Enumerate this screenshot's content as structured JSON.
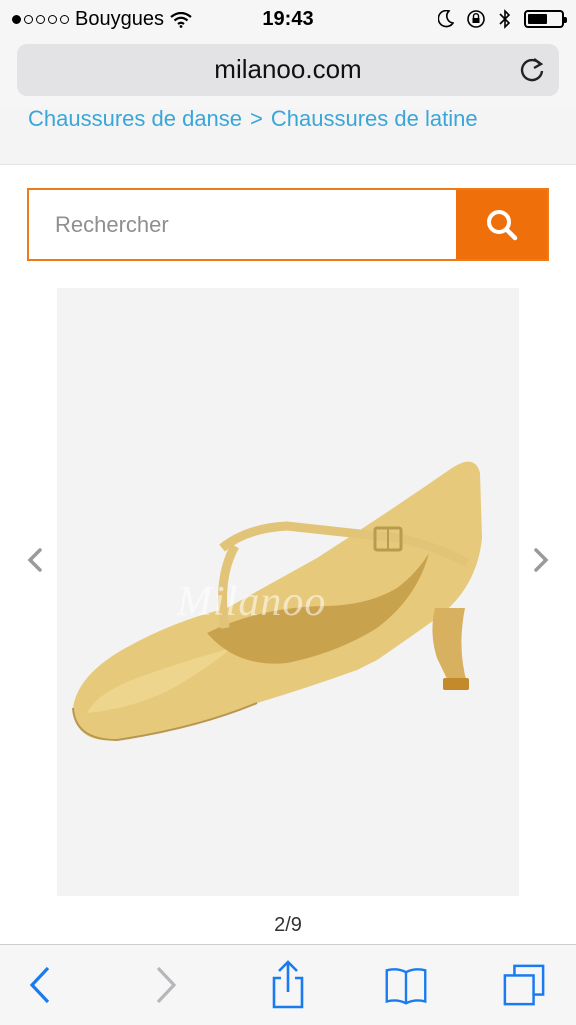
{
  "status_bar": {
    "carrier": "Bouygues",
    "time": "19:43",
    "signal_bars_filled": 1,
    "signal_bars_total": 5,
    "battery_level": 0.6
  },
  "browser": {
    "url": "milanoo.com"
  },
  "breadcrumb": {
    "items": [
      "Chaussures de danse",
      "Chaussures de latine"
    ],
    "separator": ">"
  },
  "search": {
    "placeholder": "Rechercher"
  },
  "product": {
    "watermark": "Milanoo",
    "page_indicator": "2/9"
  },
  "colors": {
    "accent_orange": "#ef6f0b",
    "link_blue": "#3aa6d8",
    "ios_blue": "#1a7bf0"
  }
}
